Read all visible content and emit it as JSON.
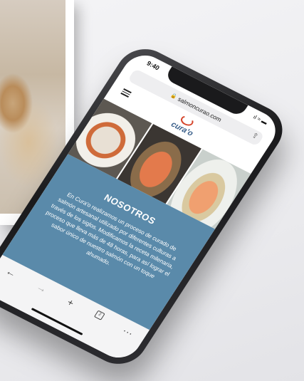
{
  "status_bar": {
    "time": "9:40",
    "icons": "ıl ≈ ▬"
  },
  "browser": {
    "url": "salmoncurao.com"
  },
  "brand": {
    "logo_text": "cura'o"
  },
  "about": {
    "title": "NOSOTROS",
    "text": "En Cura'o realizamos un proceso de curado de salmón artesanal utilizado por diferentes culturas a través de los siglos. Modificamos la receta milenaria, proceso que lleva más de 48 horas, para así lograr el sabor único de nuestro salmón con un toque ahumado."
  },
  "toolbar": {
    "back": "←",
    "forward": "→",
    "new_tab": "+",
    "tabs_count": "2",
    "more": "···"
  }
}
